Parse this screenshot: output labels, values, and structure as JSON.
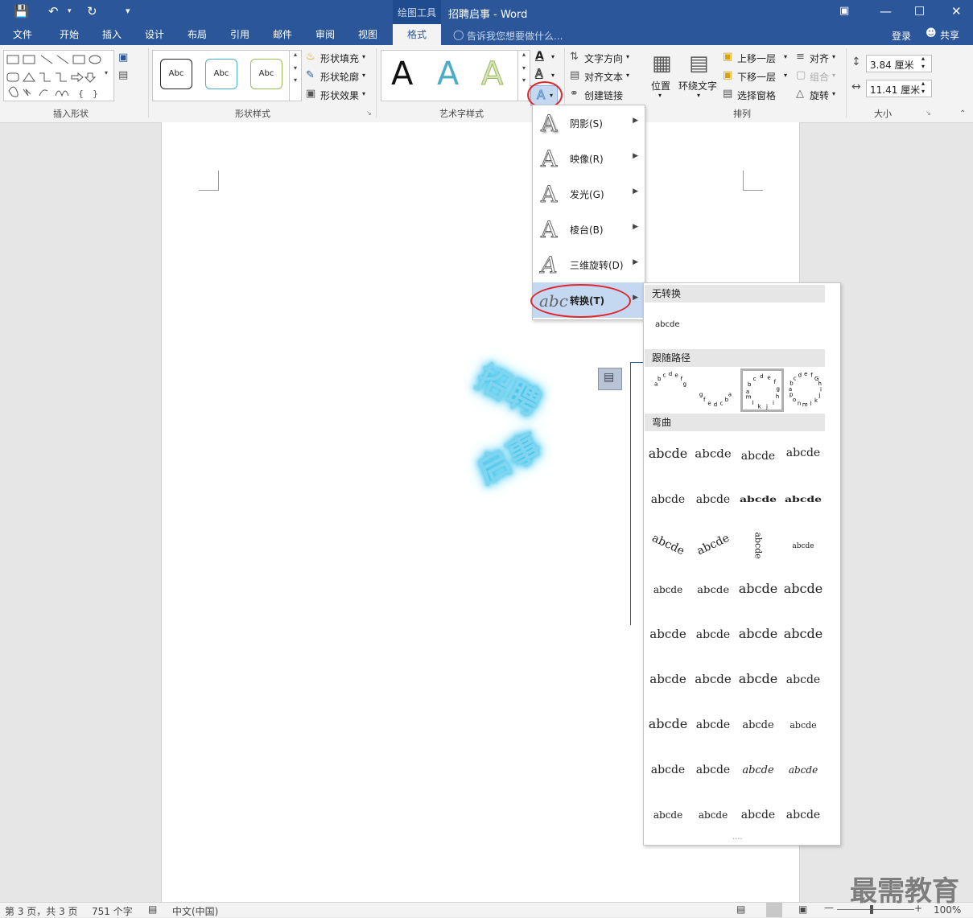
{
  "title_bar": {
    "context_tab": "绘图工具",
    "title": "招聘启事 - Word",
    "qat_more": "▾"
  },
  "tabs": [
    {
      "label": "文件"
    },
    {
      "label": "开始"
    },
    {
      "label": "插入"
    },
    {
      "label": "设计"
    },
    {
      "label": "布局"
    },
    {
      "label": "引用"
    },
    {
      "label": "邮件"
    },
    {
      "label": "审阅"
    },
    {
      "label": "视图"
    },
    {
      "label": "格式"
    }
  ],
  "tell_me": "告诉我您想要做什么...",
  "login": "登录",
  "share": "共享",
  "ribbon": {
    "insert_shapes_label": "插入形状",
    "shape_styles_label": "形状样式",
    "style_abc": "Abc",
    "shape_fill": "形状填充",
    "shape_outline": "形状轮廓",
    "shape_effects": "形状效果",
    "wordart_label": "艺术字样式",
    "wordart_letter": "A",
    "text_direction": "文字方向",
    "align_text": "对齐文本",
    "create_link": "创建链接",
    "position": "位置",
    "wrap_text": "环绕文字",
    "bring_forward": "上移一层",
    "send_backward": "下移一层",
    "selection_pane": "选择窗格",
    "align": "对齐",
    "group": "组合",
    "rotate": "旋转",
    "arrange_label": "排列",
    "height": "3.84 厘米",
    "width": "11.41 厘米",
    "size_label": "大小"
  },
  "effects_menu": [
    {
      "label": "阴影(S)"
    },
    {
      "label": "映像(R)"
    },
    {
      "label": "发光(G)"
    },
    {
      "label": "棱台(B)"
    },
    {
      "label": "三维旋转(D)"
    },
    {
      "label": "转换(T)"
    }
  ],
  "gallery": {
    "no_transform": "无转换",
    "no_transform_sample": "abcde",
    "follow_path": "跟随路径",
    "warp": "弯曲",
    "sample": "abcde",
    "more": "....",
    "follow_samples": [
      "abcdefg",
      "abcdefg",
      "abcdefghijklm",
      "abcdefGhijklmnop"
    ]
  },
  "doc": {
    "wordart_text_line1": "招聘",
    "wordart_text_line2": "启事"
  },
  "status": {
    "page": "第 3 页，共 3 页",
    "words": "751 个字",
    "lang": "中文(中国)",
    "zoom": "100%"
  },
  "watermark": "最需教育",
  "colors": {
    "brand": "#2b579a",
    "highlight_red": "#e0262b",
    "glow": "#3ec3e8"
  }
}
